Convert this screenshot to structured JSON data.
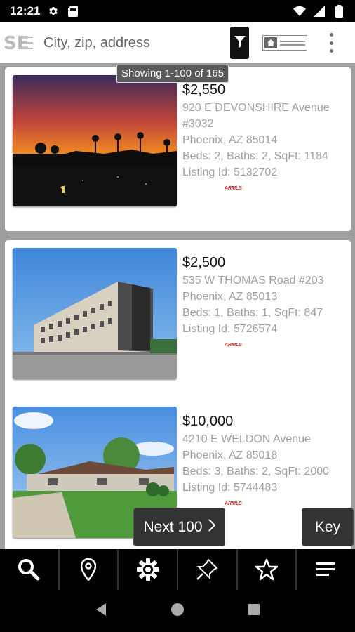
{
  "status_bar": {
    "time": "12:21",
    "left_icons": [
      "gear-icon",
      "sim-card-icon"
    ],
    "right_icons": [
      "wifi-icon",
      "signal-icon",
      "battery-icon"
    ]
  },
  "top_bar": {
    "logo": "SE",
    "search_placeholder": "City, zip, address",
    "filter_icon": "filter-icon",
    "brand_logo_label": "brand-logo",
    "more_icon": "more-vert-icon"
  },
  "results_label": "Showing 1-100 of 165",
  "listings": [
    {
      "price": "$2,550",
      "address_line1": "920 E DEVONSHIRE Avenue",
      "address_line2": "#3032",
      "city_state_zip": "Phoenix, AZ 85014",
      "details": "Beds: 2, Baths: 2, SqFt: 1184",
      "listing_id": "Listing Id: 5132702",
      "badge": "ARMLS",
      "image": "sunset-palms-photo"
    },
    {
      "price": "$2,500",
      "address_line1": "535 W THOMAS Road #203",
      "address_line2": "",
      "city_state_zip": "Phoenix, AZ 85013",
      "details": "Beds: 1, Baths: 1, SqFt: 847",
      "listing_id": "Listing Id: 5726574",
      "badge": "ARMLS",
      "image": "apartment-building-photo"
    },
    {
      "price": "$10,000",
      "address_line1": "4210 E WELDON Avenue",
      "address_line2": "",
      "city_state_zip": "Phoenix, AZ 85018",
      "details": "Beds: 3, Baths: 2, SqFt: 2000",
      "listing_id": "Listing Id: 5744483",
      "badge": "ARMLS",
      "image": "ranch-house-photo"
    }
  ],
  "buttons": {
    "next": "Next 100",
    "key": "Key"
  },
  "bottom_nav": [
    "search-icon",
    "map-pin-icon",
    "gear-icon",
    "pin-icon",
    "star-icon",
    "menu-icon"
  ],
  "system_nav": [
    "back-icon",
    "home-icon",
    "recents-icon"
  ]
}
